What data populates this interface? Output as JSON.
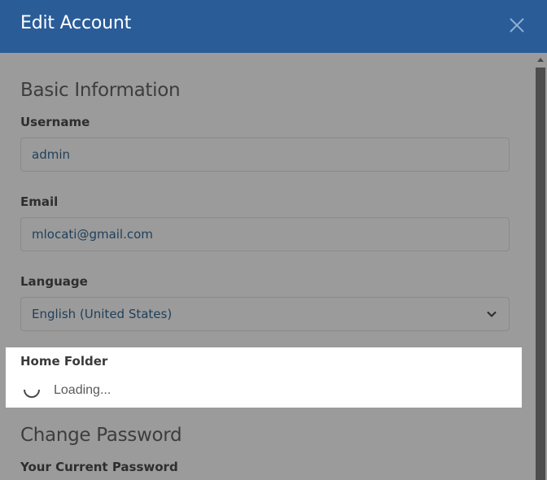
{
  "dialog": {
    "title": "Edit Account",
    "close_icon": "close-icon"
  },
  "basic": {
    "heading": "Basic Information",
    "username_label": "Username",
    "username_value": "admin",
    "email_label": "Email",
    "email_value": "mlocati@gmail.com",
    "language_label": "Language",
    "language_value": "English (United States)",
    "home_folder_label": "Home Folder",
    "home_folder_status": "Loading..."
  },
  "password": {
    "heading": "Change Password",
    "current_label": "Your Current Password"
  },
  "colors": {
    "header": "#2a5c98",
    "overlay": "#9b9b9b",
    "highlight": "#ffffff"
  }
}
